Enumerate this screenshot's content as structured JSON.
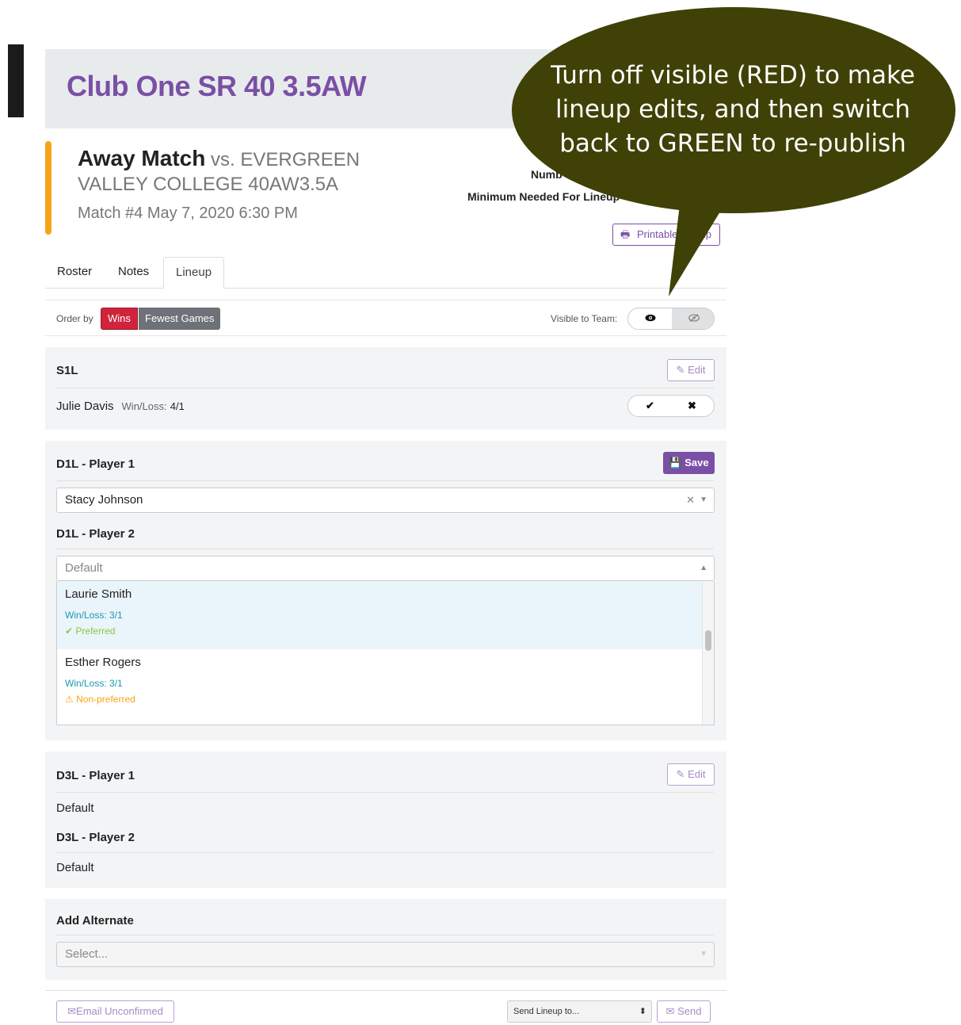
{
  "header": {
    "club_title": "Club One SR 40 3.5AW"
  },
  "match": {
    "title_strong": "Away Match",
    "title_rest": " vs. EVERGREEN VALLEY COLLEGE 40AW3.5A",
    "info": "Match #4  May 7, 2020 6:30 PM",
    "num_label": "Numb",
    "min_label": "Minimum Needed For Lineup",
    "printable_label": "Printable Lineup"
  },
  "tabs": [
    {
      "label": "Roster"
    },
    {
      "label": "Notes"
    },
    {
      "label": "Lineup"
    }
  ],
  "order": {
    "label": "Order by",
    "wins": "Wins",
    "fewest": "Fewest Games",
    "visible_label": "Visible to Team:",
    "visible_state": "off"
  },
  "s1l": {
    "title": "S1L",
    "edit": "Edit",
    "player": "Julie Davis",
    "wl_label": "Win/Loss:",
    "wl_value": "4/1",
    "confirm": "✔",
    "deny": "✖"
  },
  "d1l": {
    "player1_title": "D1L - Player 1",
    "save": "Save",
    "player1_value": "Stacy Johnson",
    "player2_title": "D1L - Player 2",
    "player2_placeholder": "Default",
    "options": [
      {
        "name": "Laurie Smith",
        "wl": "Win/Loss: 3/1",
        "status": "Preferred"
      },
      {
        "name": "Esther Rogers",
        "wl": "Win/Loss: 3/1",
        "status": "Non-preferred"
      }
    ]
  },
  "d3l": {
    "player1_title": "D3L - Player 1",
    "edit": "Edit",
    "player1_value": "Default",
    "player2_title": "D3L - Player 2",
    "player2_value": "Default"
  },
  "alternate": {
    "title": "Add Alternate",
    "placeholder": "Select..."
  },
  "footer": {
    "email_unconfirmed": "Email Unconfirmed",
    "send_lineup_to": "Send Lineup to...",
    "send": "Send"
  },
  "callout": {
    "text": "Turn off visible (RED) to make lineup edits, and then switch back to GREEN to re-publish",
    "color": "#3f4107"
  },
  "colors": {
    "brand_purple": "#7a4fa6",
    "accent_orange": "#f6a417",
    "wins_red": "#d0243c",
    "winloss_teal": "#1a9ab0",
    "preferred_green": "#8dc63f"
  }
}
